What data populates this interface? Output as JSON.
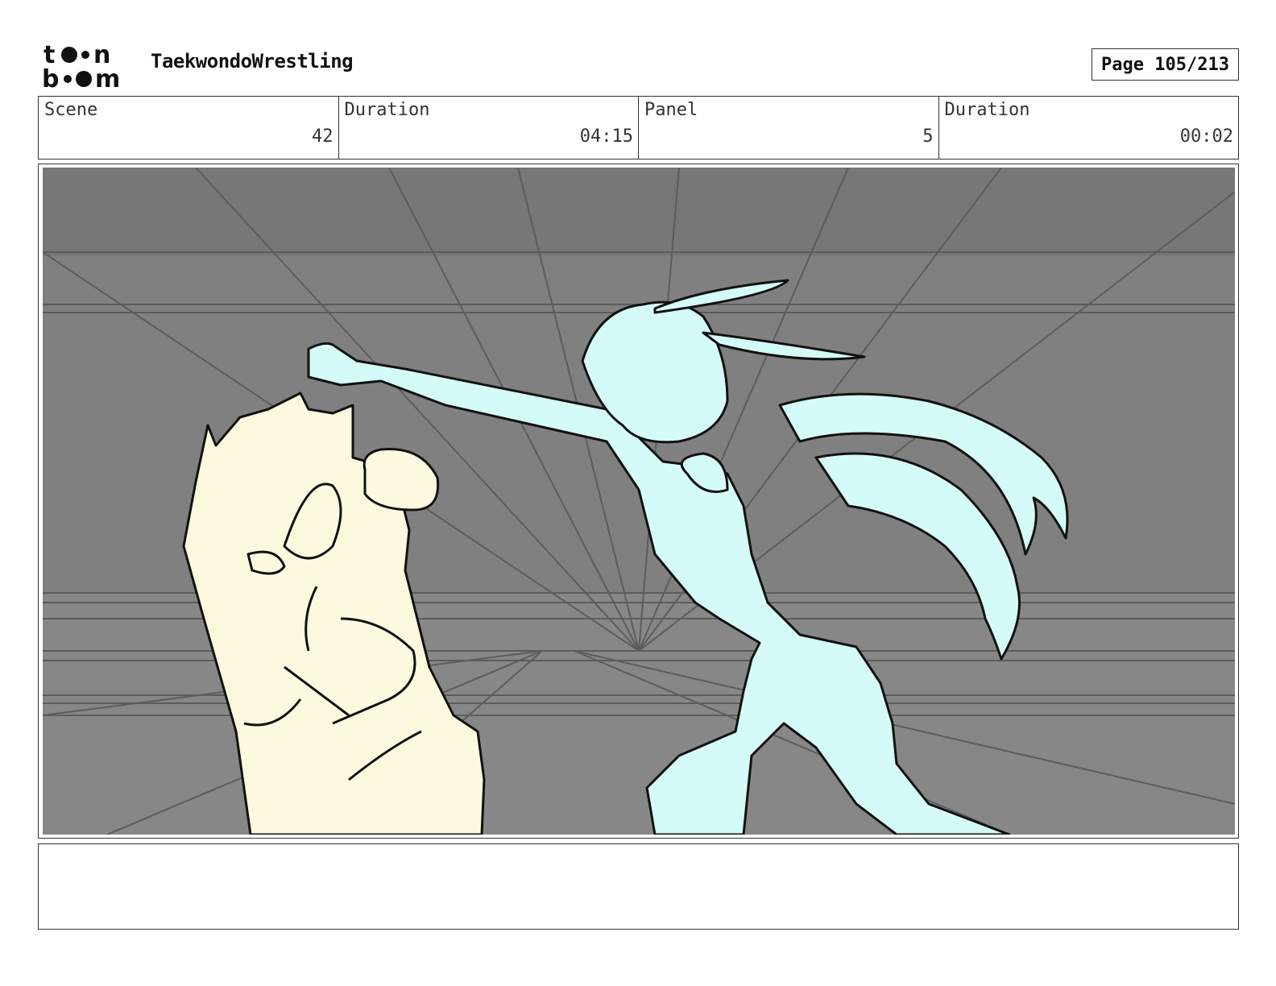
{
  "header": {
    "logo_text_top": "toon",
    "logo_text_bottom": "boom",
    "project_title": "TaekwondoWrestling",
    "page_label": "Page 105/213"
  },
  "info_row": [
    {
      "label": "Scene",
      "value": "42"
    },
    {
      "label": "Duration",
      "value": "04:15"
    },
    {
      "label": "Panel",
      "value": "5"
    },
    {
      "label": "Duration",
      "value": "00:02"
    }
  ],
  "panel_image": {
    "background_color": "#808080",
    "left_character_color": "#fdf9df",
    "right_character_color": "#d4fbf7"
  },
  "notes": {
    "text": ""
  }
}
